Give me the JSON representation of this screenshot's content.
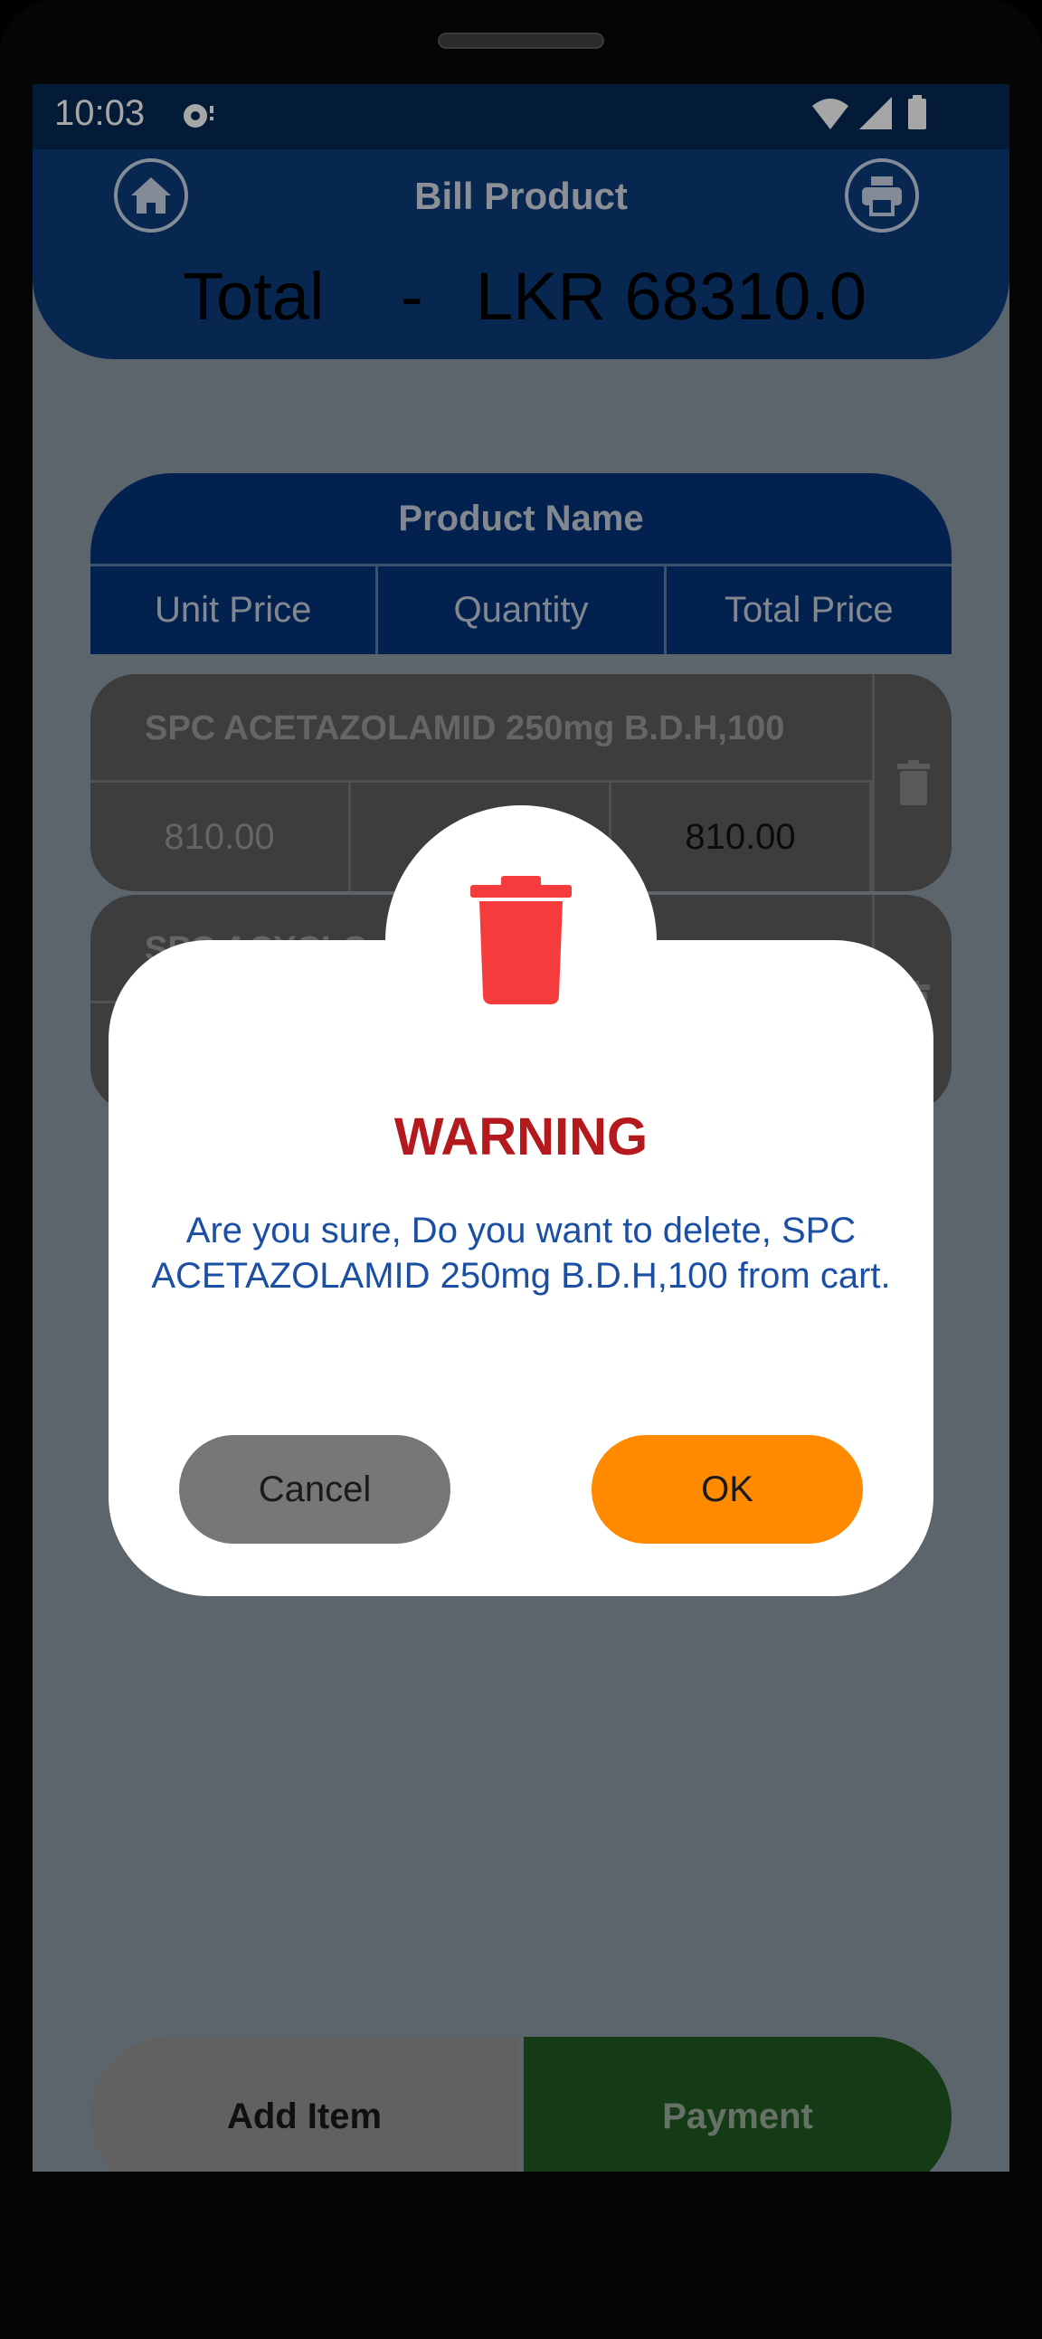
{
  "status_bar": {
    "time": "10:03"
  },
  "header": {
    "title": "Bill Product",
    "total_label": "Total",
    "total_sep": "-",
    "total_value": "LKR 68310.0"
  },
  "table": {
    "title": "Product Name",
    "columns": [
      "Unit Price",
      "Quantity",
      "Total Price"
    ]
  },
  "rows": [
    {
      "name": "SPC ACETAZOLAMID 250mg B.D.H,100",
      "unit_price": "810.00",
      "quantity": "",
      "total_price": "810.00"
    },
    {
      "name": "SPC ACYCLO…",
      "unit_price": "",
      "quantity": "",
      "total_price": ""
    }
  ],
  "buttons": {
    "add_item": "Add Item",
    "payment": "Payment"
  },
  "dialog": {
    "title": "WARNING",
    "message": "Are you sure, Do you want to delete, SPC ACETAZOLAMID 250mg B.D.H,100 from cart.",
    "cancel": "Cancel",
    "ok": "OK"
  },
  "colors": {
    "header": "#0b3c7c",
    "warning": "#b3191d",
    "ok": "#ff8a00",
    "payment": "#1f5a22"
  }
}
